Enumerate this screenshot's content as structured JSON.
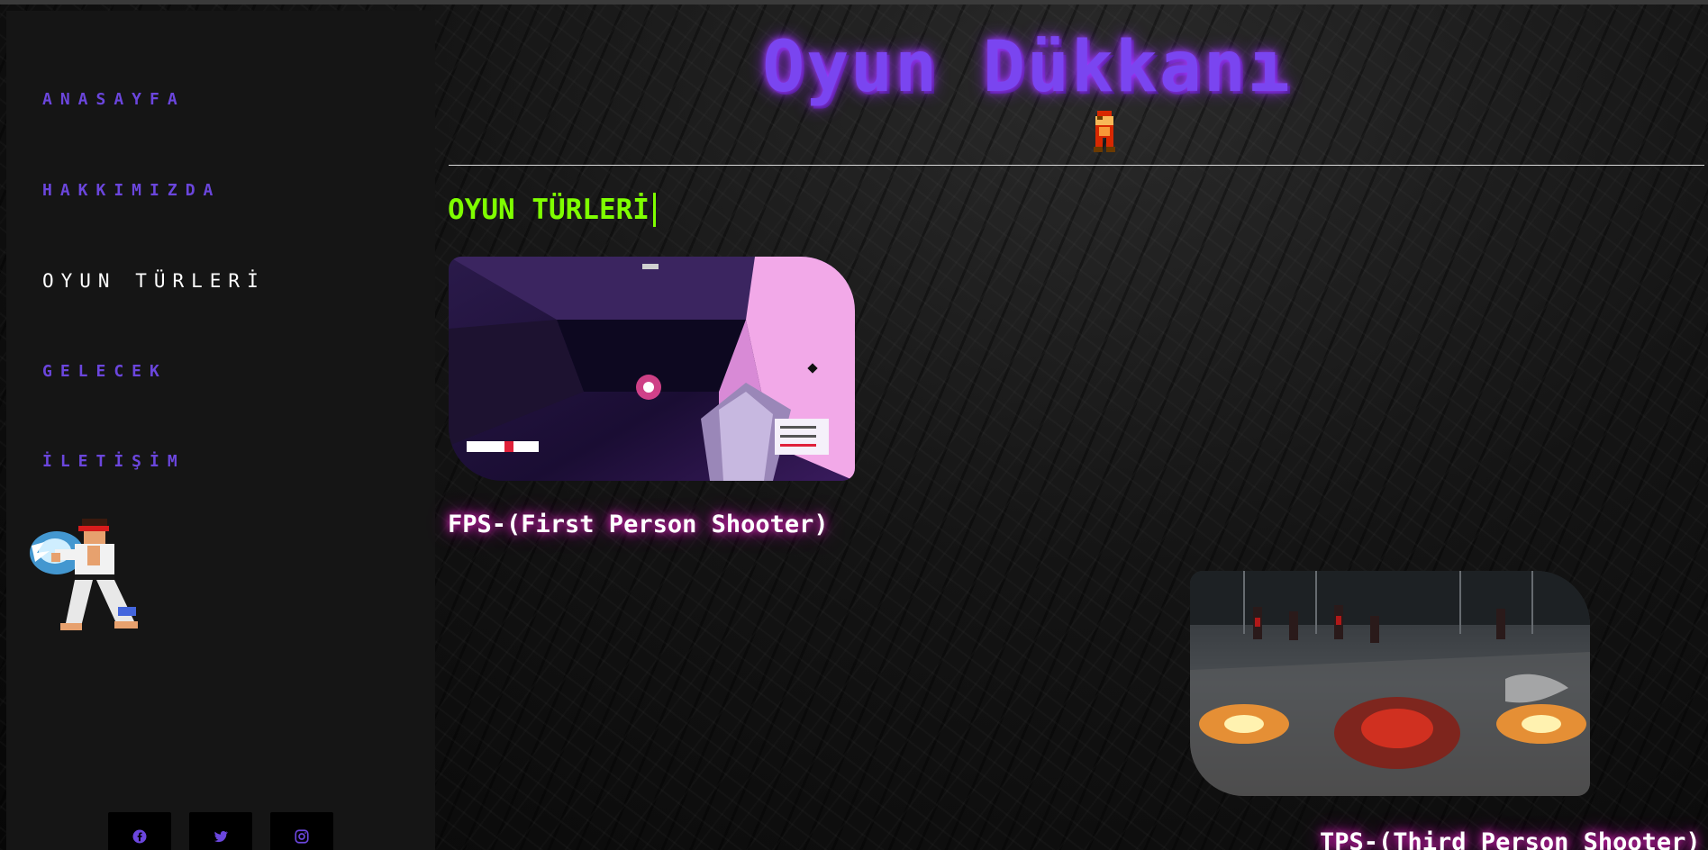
{
  "nav": {
    "items": [
      {
        "label": "ANASAYFA"
      },
      {
        "label": "HAKKIMIZDA"
      },
      {
        "label": "OYUN TÜRLERİ"
      },
      {
        "label": "GELECEK"
      },
      {
        "label": "İLETİŞİM"
      }
    ],
    "active_index": 2
  },
  "header": {
    "title": "Oyun Dükkanı"
  },
  "main": {
    "section_title": "OYUN TÜRLERİ",
    "games": [
      {
        "caption": "FPS-(First Person Shooter)",
        "image_icon": "fps-gameplay-image"
      },
      {
        "caption": "TPS-(Third Person Shooter)",
        "image_icon": "tps-gameplay-image"
      }
    ]
  },
  "social": [
    {
      "icon": "facebook-icon"
    },
    {
      "icon": "twitter-icon"
    },
    {
      "icon": "instagram-icon"
    }
  ],
  "colors": {
    "nav_link": "#6b46dd",
    "nav_active": "#ffffff",
    "title_purple": "#7a45f0",
    "heading_green": "#7fff00",
    "caption_glow": "#ff2bd6",
    "sidebar_bg": "#151515"
  }
}
